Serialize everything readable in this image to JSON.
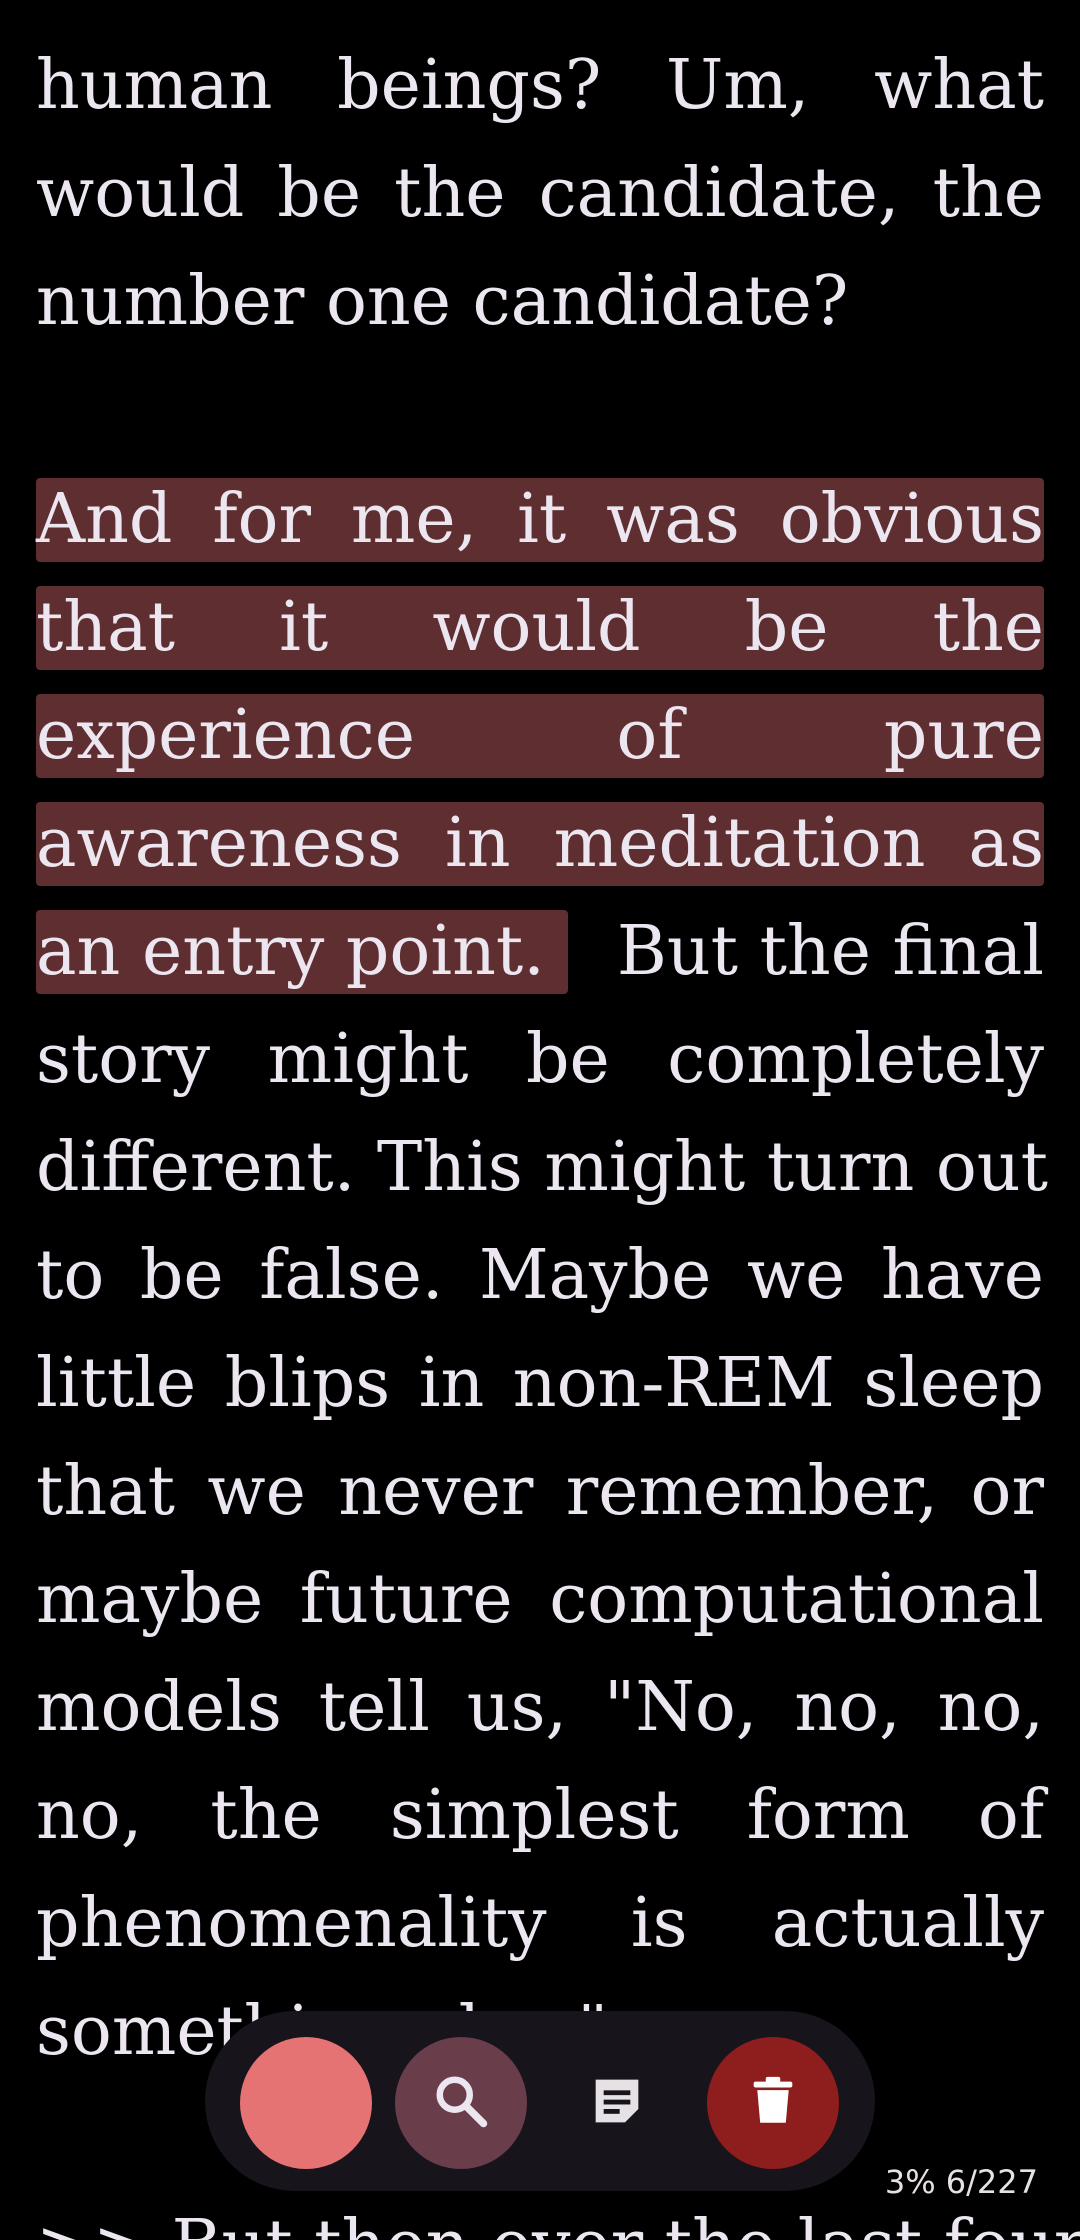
{
  "reader": {
    "lines": [
      "human beings? Um, what",
      "would be the candidate, the",
      "number one candidate?",
      "And for me, it was obvious",
      "that it would be the",
      "experience of pure",
      "awareness in meditation as",
      "an entry point.",
      " But the final",
      "story might be completely",
      "different. This might turn out",
      "to be false. Maybe we have",
      "little blips in non-REM sleep",
      "that we never remember, or",
      "maybe future computational",
      "models tell us, \"No, no, no,",
      "no, the simplest form of",
      "phenomenality is actually",
      "something else.\"",
      ">> But then over the last four"
    ],
    "highlight_color": "#5e2e30"
  },
  "toolbar": {
    "color_swatch": "#e57373",
    "icons": [
      "search-icon",
      "note-icon",
      "trash-icon"
    ]
  },
  "status": {
    "progress": "3% 6/227"
  }
}
